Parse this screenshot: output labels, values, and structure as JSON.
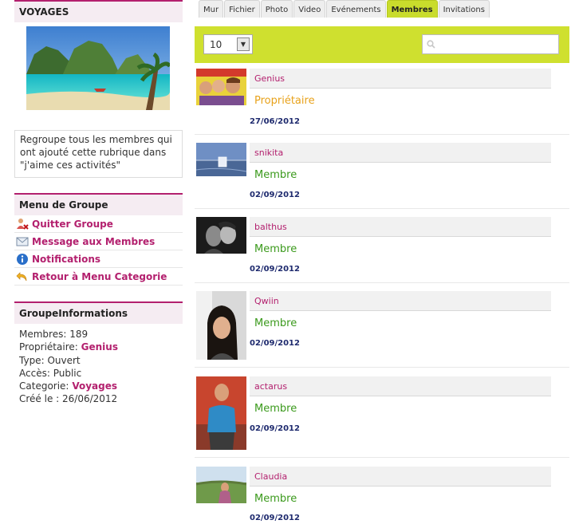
{
  "sidebar": {
    "group_title": "VOYAGES",
    "description": "Regroupe tous les membres qui ont ajouté cette rubrique dans \"j'aime ces activités\"",
    "menu_title": "Menu de Groupe",
    "menu_items": [
      {
        "label": "Quitter Groupe",
        "icon": "leave-group-icon"
      },
      {
        "label": "Message aux Membres",
        "icon": "envelope-icon"
      },
      {
        "label": "Notifications",
        "icon": "info-icon"
      },
      {
        "label": "Retour à Menu Categorie",
        "icon": "back-arrow-icon"
      }
    ],
    "info_title": "GroupeInformations",
    "info": {
      "members_label": "Membres:",
      "members_value": "189",
      "owner_label": "Propriétaire:",
      "owner_value": "Genius",
      "type_label": "Type:",
      "type_value": "Ouvert",
      "access_label": "Accès:",
      "access_value": "Public",
      "category_label": "Categorie:",
      "category_value": "Voyages",
      "created_label": "Créé le :",
      "created_value": "26/06/2012"
    }
  },
  "tabs": [
    {
      "label": "Mur",
      "active": false
    },
    {
      "label": "Fichier",
      "active": false
    },
    {
      "label": "Photo",
      "active": false
    },
    {
      "label": "Video",
      "active": false
    },
    {
      "label": "Evénements",
      "active": false
    },
    {
      "label": "Membres",
      "active": true
    },
    {
      "label": "Invitations",
      "active": false
    }
  ],
  "filter": {
    "per_page_value": "10",
    "search_placeholder": ""
  },
  "members": [
    {
      "name": "Genius",
      "role": "Propriétaire",
      "date": "27/06/2012"
    },
    {
      "name": "snikita",
      "role": "Membre",
      "date": "02/09/2012"
    },
    {
      "name": "balthus",
      "role": "Membre",
      "date": "02/09/2012"
    },
    {
      "name": "Qwiin",
      "role": "Membre",
      "date": "02/09/2012"
    },
    {
      "name": "actarus",
      "role": "Membre",
      "date": "02/09/2012"
    },
    {
      "name": "Claudia",
      "role": "Membre",
      "date": "02/09/2012"
    }
  ],
  "colors": {
    "accent": "#b3206e",
    "active_tab": "#c9dc2c",
    "filter_bar": "#cfe02f",
    "owner_role": "#e8a21b",
    "member_role": "#3b9a1c",
    "date": "#1e2a6e"
  }
}
